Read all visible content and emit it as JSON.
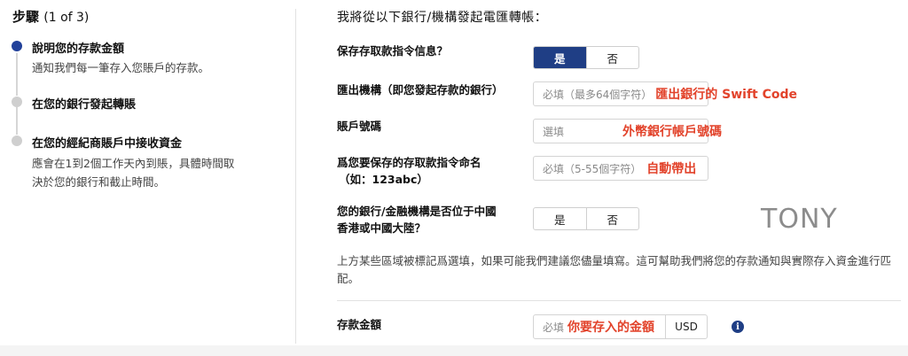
{
  "steps": {
    "title": "步驟",
    "progress": "(1 of 3)",
    "items": [
      {
        "title": "說明您的存款金額",
        "desc": "通知我們每一筆存入您賬戶的存款。",
        "state": "active"
      },
      {
        "title": "在您的銀行發起轉賬",
        "desc": "",
        "state": "pending"
      },
      {
        "title": "在您的經紀商賬戶中接收資金",
        "desc": "應會在1到2個工作天內到賬，具體時間取決於您的銀行和截止時間。",
        "state": "pending"
      }
    ]
  },
  "form": {
    "header": "我將從以下銀行/機構發起電匯轉帳：",
    "save_instructions": {
      "label": "保存存取款指令信息？",
      "options": [
        "是",
        "否"
      ],
      "selected": "是"
    },
    "sending_institution": {
      "label": "匯出機構（即您發起存款的銀行）",
      "placeholder": "必填（最多64個字符）",
      "annotation": "匯出銀行的 Swift Code"
    },
    "account_number": {
      "label": "賬戶號碼",
      "placeholder": "選填",
      "annotation": "外幣銀行帳戶號碼"
    },
    "instruction_name": {
      "label_line1": "爲您要保存的存取款指令命名",
      "label_line2": "（如：123abc）",
      "placeholder": "必填（5-55個字符）",
      "annotation": "自動帶出"
    },
    "in_greater_china": {
      "label_line1": "您的銀行/金融機構是否位于中國",
      "label_line2": "香港或中國大陸？",
      "options": [
        "是",
        "否"
      ],
      "selected": null
    },
    "watermark": "TONY",
    "notice": "上方某些區域被標記爲選填，如果可能我們建議您儘量填寫。這可幫助我們將您的存款通知與實際存入資金進行匹配。",
    "deposit_amount": {
      "label": "存款金額",
      "placeholder": "必填",
      "annotation": "你要存入的金額",
      "currency": "USD",
      "info_icon": "i"
    }
  },
  "colors": {
    "accent": "#1f3e85",
    "active_step": "#22419a",
    "annotation": "#e2432b"
  }
}
